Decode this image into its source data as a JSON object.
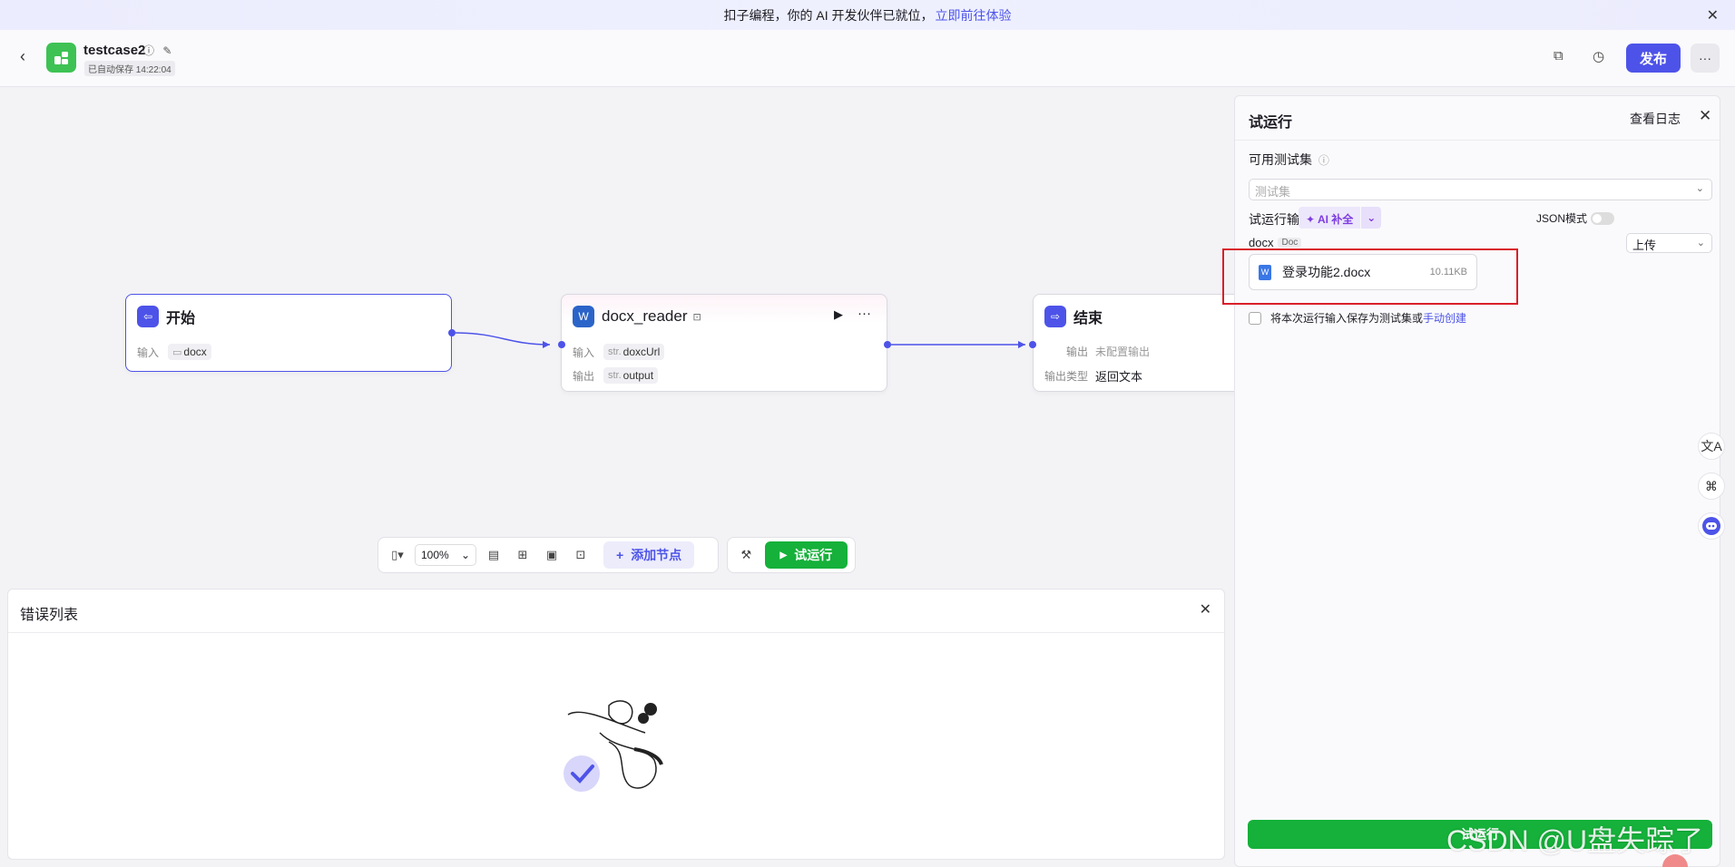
{
  "banner": {
    "text": "扣子编程，你的 AI 开发伙伴已就位，",
    "link": "立即前往体验"
  },
  "header": {
    "app_name": "testcase2",
    "autosave": "已自动保存 14:22:04",
    "publish": "发布",
    "more": "···"
  },
  "nodes": {
    "start": {
      "title": "开始",
      "input_label": "输入",
      "input_value": "docx"
    },
    "reader": {
      "title": "docx_reader",
      "input_label": "输入",
      "input_type": "str.",
      "input_value": "doxcUrl",
      "output_label": "输出",
      "output_type": "str.",
      "output_value": "output"
    },
    "end": {
      "title": "结束",
      "output_label": "输出",
      "output_value": "未配置输出",
      "output_type_label": "输出类型",
      "output_type_value": "返回文本"
    }
  },
  "toolbar": {
    "zoom": "100%",
    "add_node": "添加节点",
    "test_run": "试运行"
  },
  "error_panel": {
    "title": "错误列表"
  },
  "test_panel": {
    "title": "试运行",
    "view_log": "查看日志",
    "testset_label": "可用测试集",
    "testset_placeholder": "测试集",
    "input_label": "试运行输入",
    "json_mode": "JSON模式",
    "ai_fill": "AI 补全",
    "field_name": "docx",
    "field_tag": "Doc",
    "upload_mode": "上传",
    "file_name": "登录功能2.docx",
    "file_size": "10.11KB",
    "save_text": "将本次运行输入保存为测试集或",
    "save_link": "手动创建",
    "run_button": "试运行"
  },
  "watermark": "CSDN @U盘失踪了",
  "colors": {
    "accent": "#4d53e8",
    "run_green": "#15b13a",
    "highlight_red": "#d9202a",
    "logo_green": "#3ec254"
  }
}
